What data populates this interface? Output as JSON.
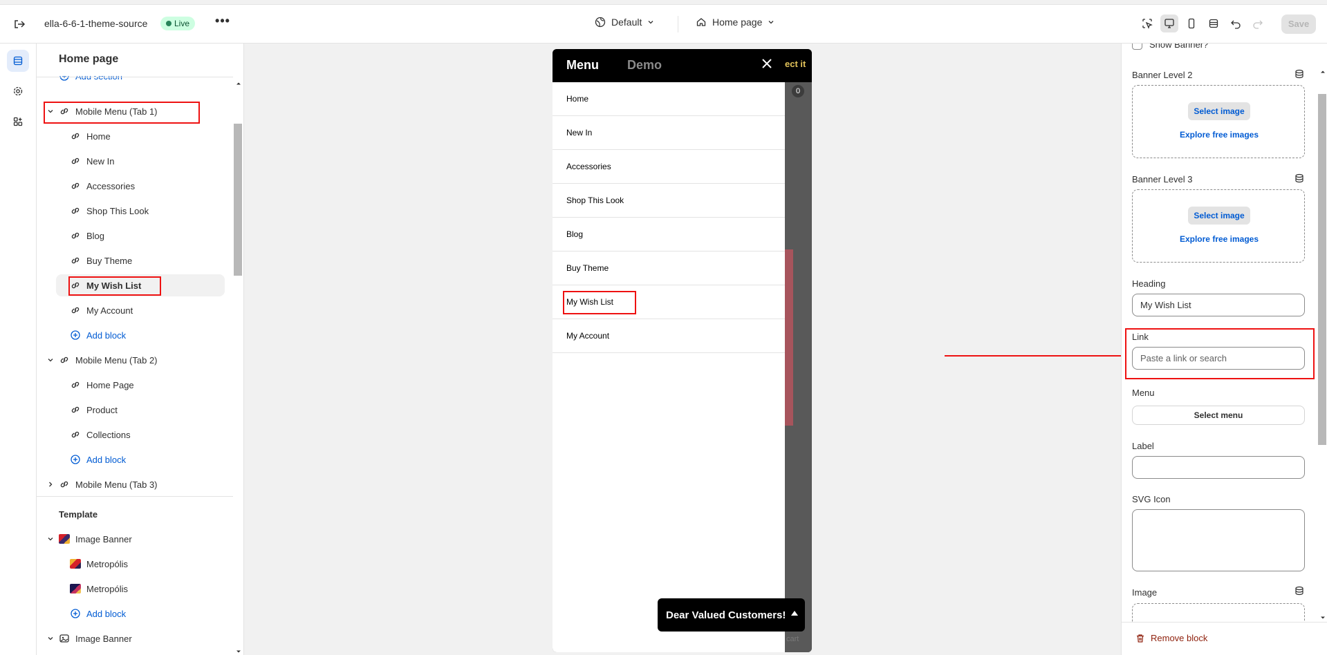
{
  "topbar": {
    "store_name": "ella-6-6-1-theme-source",
    "live_badge": "Live",
    "more_label": "•••",
    "theme_selector": "Default",
    "page_selector": "Home page",
    "save_label": "Save"
  },
  "sidebar": {
    "title": "Home page",
    "add_section": "Add section",
    "groups": [
      {
        "label": "Mobile Menu (Tab 1)",
        "expanded": true,
        "items": [
          "Home",
          "New In",
          "Accessories",
          "Shop This Look",
          "Blog",
          "Buy Theme",
          "My Wish List",
          "My Account"
        ],
        "selected": "My Wish List",
        "add_block": "Add block"
      },
      {
        "label": "Mobile Menu (Tab 2)",
        "expanded": true,
        "items": [
          "Home Page",
          "Product",
          "Collections"
        ],
        "add_block": "Add block"
      },
      {
        "label": "Mobile Menu (Tab 3)",
        "expanded": false
      }
    ],
    "template_label": "Template",
    "template_sections": [
      {
        "label": "Image Banner",
        "items": [
          "Metropólis",
          "Metropólis"
        ],
        "add_block": "Add block"
      },
      {
        "label": "Image Banner"
      }
    ]
  },
  "preview": {
    "tab_menu": "Menu",
    "tab_demo": "Demo",
    "peek_text": "ect it",
    "cart_count": "0",
    "cart_text": "cart",
    "menu_items": [
      "Home",
      "New In",
      "Accessories",
      "Shop This Look",
      "Blog",
      "Buy Theme",
      "My Wish List",
      "My Account"
    ],
    "toast": "Dear Valued Customers!"
  },
  "settings": {
    "show_banner": "Show Banner?",
    "banner_level_2": "Banner Level 2",
    "banner_level_3": "Banner Level 3",
    "select_image": "Select image",
    "explore_images": "Explore free images",
    "heading_label": "Heading",
    "heading_value": "My Wish List",
    "link_label": "Link",
    "link_placeholder": "Paste a link or search",
    "menu_label": "Menu",
    "select_menu": "Select menu",
    "label_label": "Label",
    "svg_icon_label": "SVG Icon",
    "image_label": "Image",
    "remove_block": "Remove block"
  },
  "colors": {
    "accent": "#005bd3",
    "annotation": "#ee1111",
    "live_bg": "#cdfee1",
    "danger": "#8e1f0b"
  }
}
